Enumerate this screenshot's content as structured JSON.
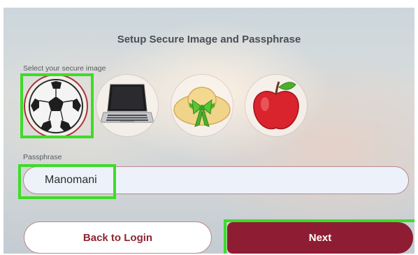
{
  "setup": {
    "title": "Setup Secure Image and Passphrase",
    "image_label": "Select your secure image",
    "images": [
      {
        "name": "soccer-ball",
        "selected": true
      },
      {
        "name": "laptop",
        "selected": false
      },
      {
        "name": "straw-hat-with-green-bow",
        "selected": false
      },
      {
        "name": "red-apple",
        "selected": false
      }
    ],
    "passphrase_label": "Passphrase",
    "passphrase_value": "Manomani",
    "back_label": "Back to Login",
    "next_label": "Next"
  },
  "colors": {
    "accent": "#8e1d33",
    "highlight": "#3ddc27",
    "selected_ring": "#a8323d",
    "input_bg": "#edf1fa"
  }
}
